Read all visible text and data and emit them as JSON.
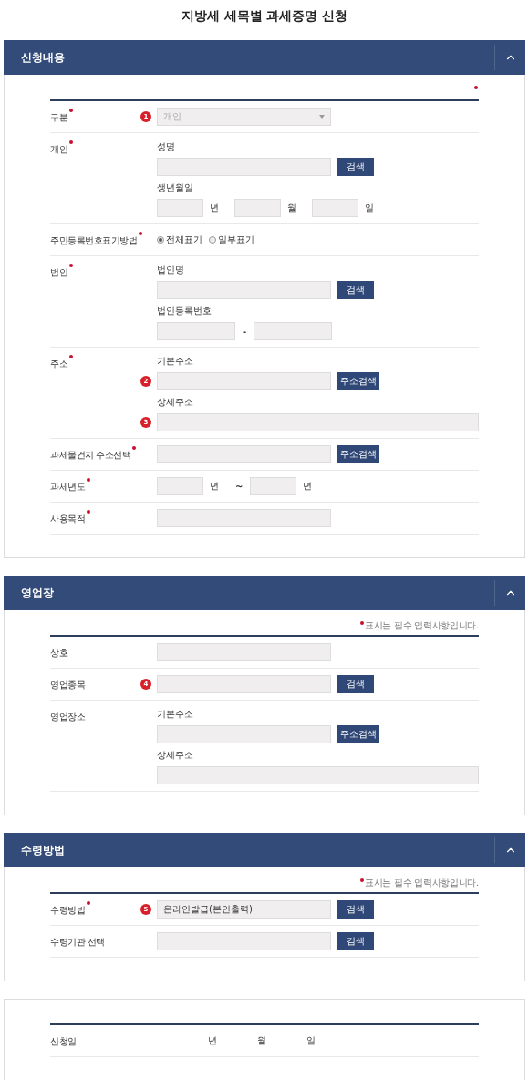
{
  "title": "지방세 세목별 과세증명 신청",
  "panels": [
    {
      "heading": "신청내용",
      "expanded": true,
      "note": {
        "mark": true
      },
      "rows": [
        {
          "label": "구분",
          "required": true,
          "fields": [
            {
              "kind": "select",
              "badge": "1",
              "value": "개인",
              "disabled": true
            }
          ]
        },
        {
          "label": "개인",
          "required": true,
          "fields": [
            {
              "kind": "caption",
              "text": "성명"
            },
            {
              "kind": "input_button",
              "button": "검색"
            },
            {
              "kind": "caption",
              "text": "생년월일"
            },
            {
              "kind": "dates",
              "units": [
                "년",
                "월",
                "일"
              ]
            }
          ]
        },
        {
          "label": "주민등록번호표기방법",
          "required": true,
          "fields": [
            {
              "kind": "radio",
              "options": [
                {
                  "label": "전체표기",
                  "selected": true
                },
                {
                  "label": "일부표기",
                  "selected": false
                }
              ]
            }
          ]
        },
        {
          "label": "법인",
          "required": true,
          "fields": [
            {
              "kind": "caption",
              "text": "법인명"
            },
            {
              "kind": "input_button",
              "button": "검색"
            },
            {
              "kind": "caption",
              "text": "법인등록번호"
            },
            {
              "kind": "split",
              "separator": "-"
            }
          ]
        },
        {
          "label": "주소",
          "required": true,
          "fields": [
            {
              "kind": "caption",
              "text": "기본주소"
            },
            {
              "kind": "input_button",
              "badge": "2",
              "button": "주소검색"
            },
            {
              "kind": "caption",
              "text": "상세주소"
            },
            {
              "kind": "input_wide",
              "badge": "3"
            }
          ]
        },
        {
          "label": "과세물건지 주소선택",
          "required": true,
          "fields": [
            {
              "kind": "input_button",
              "button": "주소검색"
            }
          ]
        },
        {
          "label": "과세년도",
          "required": true,
          "fields": [
            {
              "kind": "range",
              "units": [
                "년",
                "년"
              ],
              "separator": "~"
            }
          ]
        },
        {
          "label": "사용목적",
          "required": true,
          "fields": [
            {
              "kind": "input"
            }
          ]
        }
      ]
    },
    {
      "heading": "영업장",
      "expanded": true,
      "note": {
        "mark": true,
        "text": "표시는 필수 입력사항입니다."
      },
      "rows": [
        {
          "label": "상호",
          "required": false,
          "fields": [
            {
              "kind": "input"
            }
          ]
        },
        {
          "label": "영업종목",
          "required": false,
          "fields": [
            {
              "kind": "input_button",
              "badge": "4",
              "button": "검색"
            }
          ]
        },
        {
          "label": "영업장소",
          "required": false,
          "fields": [
            {
              "kind": "caption",
              "text": "기본주소"
            },
            {
              "kind": "input_button",
              "button": "주소검색"
            },
            {
              "kind": "caption",
              "text": "상세주소"
            },
            {
              "kind": "input_wide"
            }
          ]
        }
      ]
    },
    {
      "heading": "수령방법",
      "expanded": true,
      "note": {
        "mark": true,
        "text": "표시는 필수 입력사항입니다."
      },
      "rows": [
        {
          "label": "수령방법",
          "required": true,
          "fields": [
            {
              "kind": "input_button",
              "badge": "5",
              "value": "온라인발급(본인출력)",
              "button": "검색"
            }
          ]
        },
        {
          "label": "수령기관 선택",
          "required": false,
          "fields": [
            {
              "kind": "input_button",
              "button": "검색"
            }
          ]
        }
      ]
    },
    {
      "rows": [
        {
          "label": "신청일",
          "required": false,
          "fields": [
            {
              "kind": "date_text",
              "units": [
                "년",
                "월",
                "일"
              ]
            }
          ]
        }
      ]
    }
  ]
}
